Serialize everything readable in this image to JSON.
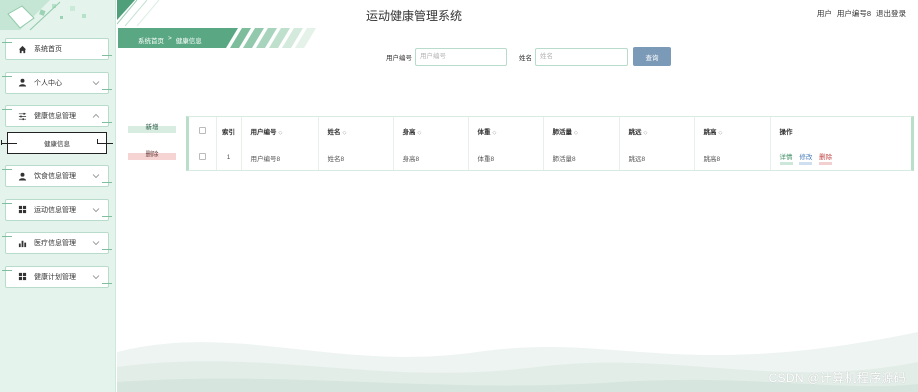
{
  "app": {
    "title": "运动健康管理系统",
    "user_label": "用户",
    "user_name": "用户编号8",
    "logout_label": "退出登录"
  },
  "breadcrumb": {
    "home": "系统首页",
    "sep": ">",
    "current": "健康信息"
  },
  "sidebar": {
    "items": [
      {
        "label": "系统首页",
        "icon": "home-icon"
      },
      {
        "label": "个人中心",
        "icon": "user-icon"
      },
      {
        "label": "健康信息管理",
        "icon": "sliders-icon",
        "expanded": true
      },
      {
        "label": "饮食信息管理",
        "icon": "user-icon"
      },
      {
        "label": "运动信息管理",
        "icon": "grid-icon"
      },
      {
        "label": "医疗信息管理",
        "icon": "bar-chart-icon"
      },
      {
        "label": "健康计划管理",
        "icon": "grid-icon"
      }
    ],
    "active_sub": "健康信息"
  },
  "search": {
    "field1_label": "用户编号",
    "field1_placeholder": "用户编号",
    "field2_label": "姓名",
    "field2_placeholder": "姓名",
    "button": "查询"
  },
  "actions": {
    "add": "新增",
    "delete": "删除"
  },
  "table": {
    "headers": {
      "index": "索引",
      "user_id": "用户编号",
      "name": "姓名",
      "height": "身高",
      "weight": "体重",
      "lung": "肺活量",
      "long_jump": "跳远",
      "high_jump": "跳高",
      "ops": "操作"
    },
    "rows": [
      {
        "index": "1",
        "user_id": "用户编号8",
        "name": "姓名8",
        "height": "身高8",
        "weight": "体重8",
        "lung": "肺活量8",
        "long_jump": "跳远8",
        "high_jump": "跳高8"
      }
    ],
    "row_ops": {
      "detail": "详情",
      "edit": "修改",
      "delete": "删除"
    }
  },
  "watermark": "CSDN @计算机程序源码",
  "colors": {
    "sidebar_bg": "#e4f3ec",
    "accent_green": "#5aa883",
    "search_button": "#7b9ab8",
    "delete_red": "#c24545",
    "edit_blue": "#4a7db8"
  }
}
